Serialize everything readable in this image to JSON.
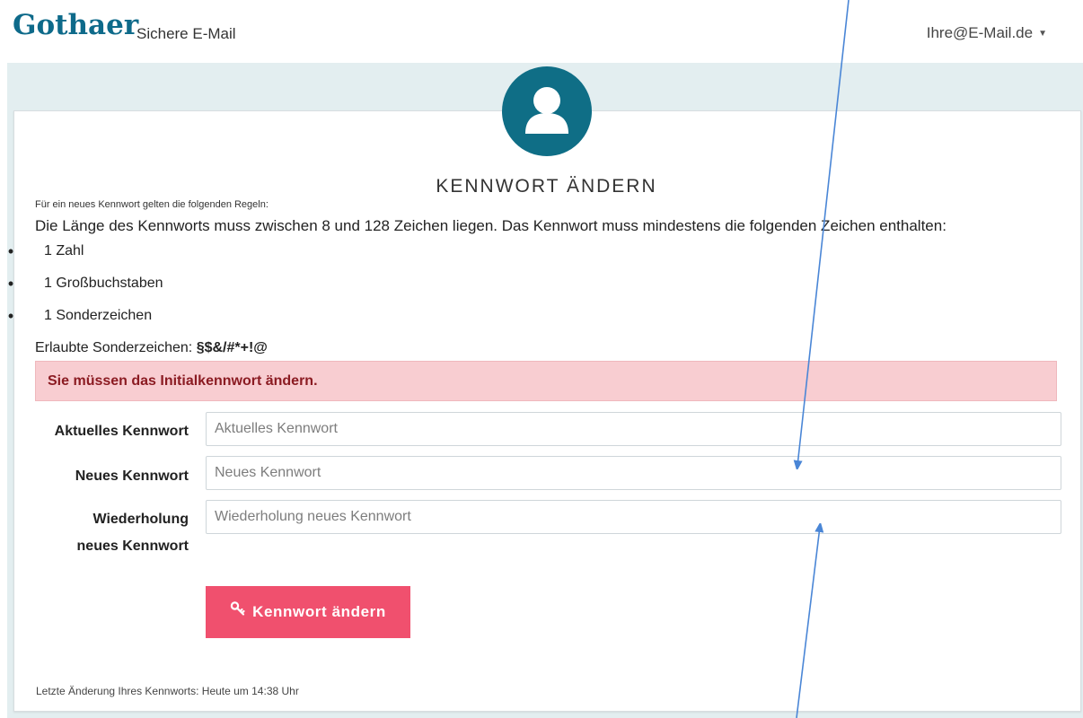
{
  "header": {
    "logo": "Gothaer",
    "app_title": "Sichere E-Mail",
    "user_email": "Ihre@E-Mail.de",
    "caret_icon": "chevron-down-icon"
  },
  "main": {
    "avatar_icon": "user-icon",
    "title": "KENNWORT ÄNDERN",
    "rules_intro": "Für ein neues Kennwort gelten die folgenden Regeln:",
    "rules_main": "Die Länge des Kennworts muss zwischen 8 und 128 Zeichen liegen. Das Kennwort muss mindestens die folgenden Zeichen enthalten:",
    "rules": [
      "1 Zahl",
      "1 Großbuchstaben",
      "1 Sonderzeichen"
    ],
    "allowed_label": "Erlaubte Sonderzeichen:",
    "allowed_chars": "§$&/#*+!@",
    "alert": "Sie müssen das Initialkennwort ändern.",
    "fields": {
      "current": {
        "label": "Aktuelles Kennwort",
        "placeholder": "Aktuelles Kennwort",
        "value": ""
      },
      "new": {
        "label": "Neues Kennwort",
        "placeholder": "Neues Kennwort",
        "value": ""
      },
      "repeat": {
        "label_line1": "Wiederholung",
        "label_line2": "neues Kennwort",
        "placeholder": "Wiederholung neues Kennwort",
        "value": ""
      }
    },
    "submit_label": "Kennwort ändern",
    "submit_icon": "key-icon",
    "last_change": "Letzte Änderung Ihres Kennworts: Heute um 14:38 Uhr"
  },
  "colors": {
    "brand": "#0e6a8a",
    "avatar_bg": "#0f6e86",
    "band_bg": "#e3eef0",
    "alert_bg": "#f8cdd1",
    "alert_text": "#8b1b22",
    "button_bg": "#f0506e",
    "annotation_arrow": "#4a86d6"
  }
}
